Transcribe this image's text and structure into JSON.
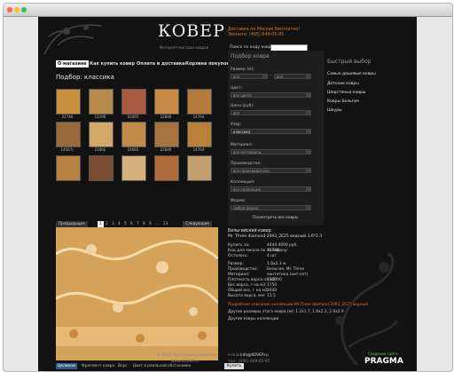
{
  "site": {
    "logo": "КОВЕР",
    "tagline": "Интернет-магазин   ковров"
  },
  "contacts": {
    "delivery": "Доставка по Москве бесплатно!",
    "phone": "Звоните: (495) 649-05-95"
  },
  "search": {
    "placeholder": "Поиск по коду ковра:"
  },
  "nav": [
    {
      "label": "О магазине",
      "active": true
    },
    {
      "label": "Как купить ковер",
      "active": false
    },
    {
      "label": "Оплата и доставка",
      "active": false
    },
    {
      "label": "Корзина покупок",
      "active": false
    }
  ],
  "heading": "Подбор: классика",
  "thumbnails_row1": [
    "22748",
    "12296",
    "03465",
    "22846",
    "14764"
  ],
  "thumbnails_row2": [
    "14567c",
    "23462",
    "24665",
    "22846",
    "14764"
  ],
  "thumbnails_row3": [
    "",
    "",
    "",
    "",
    ""
  ],
  "pager": {
    "prev": "Предыдущие",
    "next": "Следующие",
    "pages": [
      "1",
      "2",
      "3",
      "4",
      "5",
      "6",
      "7",
      "8",
      "9",
      "...",
      "23"
    ]
  },
  "filter": {
    "title": "Подбор ковра",
    "size_label": "Размер (м):",
    "from": "все",
    "to": "все",
    "color_label": "Цвет:",
    "color_value": "все цвета",
    "price_label": "Цена (руб):",
    "price_value": "все",
    "pattern_label": "Узор:",
    "pattern_value": "классика",
    "material_label": "Материал:",
    "material_value": "все материалы",
    "producer_label": "Производство:",
    "producer_value": "все производители",
    "collection_label": "Коллекция:",
    "collection_value": "все коллекции",
    "shape_label": "Форма:",
    "shape_value": "любая форма",
    "show_all": "Посмотреть все ковры"
  },
  "quick": {
    "title": "Быстрый выбор",
    "items": [
      "Самые дешевые ковры",
      "Детские ковры",
      "Шерстяные ковры",
      "Ковры Бельгия",
      "Шкуры"
    ]
  },
  "product": {
    "title": "Бельгийский ковер",
    "name": "Mr. Three diamond 2093_2E25 ведный 1.6*2.3",
    "rows": [
      [
        "Купить за:",
        "4444 4000 руб."
      ],
      [
        "Код для заказа по телефону:",
        "22748"
      ],
      [
        "Осталось:",
        "4 шт"
      ],
      [
        "Размер:",
        "1.6x2.3 м"
      ],
      [
        "Производство:",
        "Бельгия, Mr. Three"
      ],
      [
        "Материал:",
        "синтетика (хит-сет)"
      ],
      [
        "Плотность ворса на м2:",
        "250000"
      ],
      [
        "Вес ворса, г на м2:",
        "1750"
      ],
      [
        "Общий вес, г на м2:",
        "2440"
      ],
      [
        "Высота ворса, мм:",
        "11.5"
      ]
    ],
    "more_link": "Подробное описание коллекции Mr.Three diamond 2093_2E25 ведный",
    "other_sizes": "Другие размеры этого ковра (м): 1.2x1.7, 1.6x2.3, 2.0x2.9",
    "other_collection": "Другие ковры коллекции"
  },
  "view_tabs": [
    "Целиком",
    "Фрагмент ковра",
    "Ворс",
    "Цвет в реальной обстановке"
  ],
  "buy": "Купить",
  "footer": {
    "copyright": "© 2007 Все права защищены",
    "site": "www.KOVEP.ru",
    "email_label": "e-mail:",
    "email": "info@KOVEP.ru",
    "tel": "тел.: (495) 649-05-95"
  },
  "pragma": {
    "caption": "Создание сайта",
    "name": "PRAGMA"
  },
  "colors": {
    "accent": "#e07a1f",
    "bg": "#121212",
    "rug": "#d5a25a"
  }
}
